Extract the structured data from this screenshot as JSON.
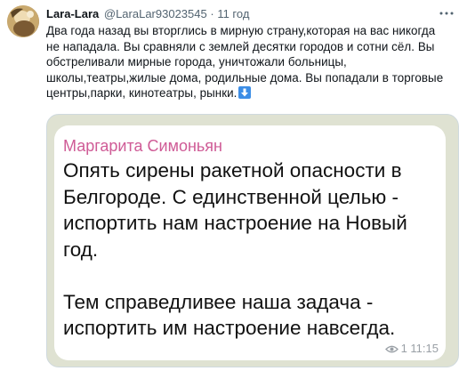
{
  "tweet": {
    "display_name": "Lara-Lara",
    "handle": "@LaraLar93023545",
    "separator": "·",
    "time": "11 год",
    "text_lines": [
      "Два года назад вы вторглись в мирную страну,которая на вас никогда",
      "не нападала. Вы сравняли с землей десятки городов и сотни сёл. Вы",
      "обстреливали мирные города, уничтожали больницы,",
      "школы,театры,жилые дома, родильные дома. Вы попадали в торговые",
      "центры,парки, кинотеатры, рынки."
    ],
    "trailing_emoji": "down-arrow-emoji"
  },
  "media": {
    "sender": "Маргарита Симоньян",
    "message_lines_1": [
      "Опять сирены ракетной опасности в",
      "Белгороде. С единственной целью -",
      "испортить нам настроение на Новый",
      "год."
    ],
    "message_lines_2": [
      "Тем справедливее наша задача -",
      "испортить им настроение навсегда."
    ],
    "views_and_time": "1 11:15"
  },
  "colors": {
    "sender_name": "#cf5b96",
    "chat_background": "#dfe2d2",
    "secondary_text": "#536471"
  }
}
